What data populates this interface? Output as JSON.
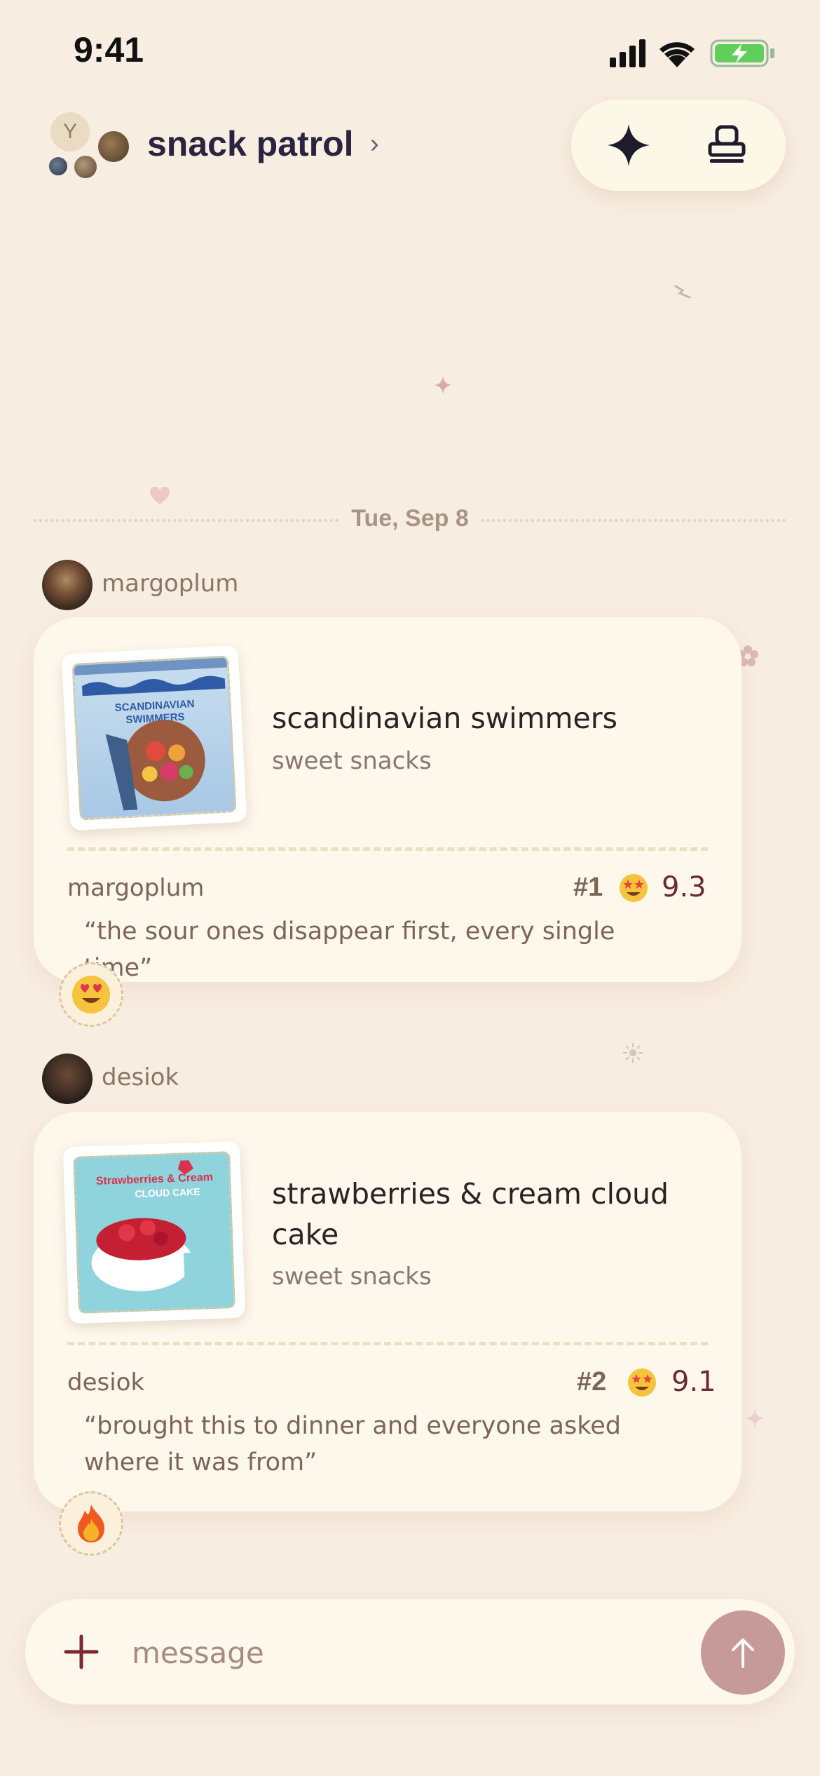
{
  "status": {
    "time": "9:41"
  },
  "header": {
    "title": "snack patrol",
    "avatar_letter": "Y",
    "chevron": "chevron-right-icon",
    "actions": [
      "sparkle-icon",
      "stamp-icon"
    ]
  },
  "date_divider": "Tue, Sep 8",
  "messages": [
    {
      "sender": "margoplum",
      "product": {
        "title": "scandinavian swimmers",
        "category": "sweet snacks"
      },
      "reviewer": "margoplum",
      "rank": "#1",
      "rank_emoji": "star-struck-emoji",
      "score": "9.3",
      "quote": "“the sour ones disappear first, every single time”",
      "reaction": "heart-eyes-emoji",
      "thumb_text": [
        "SCANDINAVIAN",
        "SWIMMERS"
      ]
    },
    {
      "sender": "desiok",
      "product": {
        "title": "strawberries & cream cloud cake",
        "category": "sweet snacks"
      },
      "reviewer": "desiok",
      "rank": "#2",
      "rank_emoji": "star-struck-emoji",
      "score": "9.1",
      "quote": "“brought this to dinner and everyone asked where it was from”",
      "reaction": "fire-emoji",
      "thumb_text": [
        "Strawberries & Cream",
        "CLOUD CAKE"
      ]
    }
  ],
  "composer": {
    "placeholder": "message"
  },
  "colors": {
    "background": "#f8ede1",
    "card": "#fef7eb",
    "accent": "#6a2a38",
    "send": "#c59a98"
  }
}
